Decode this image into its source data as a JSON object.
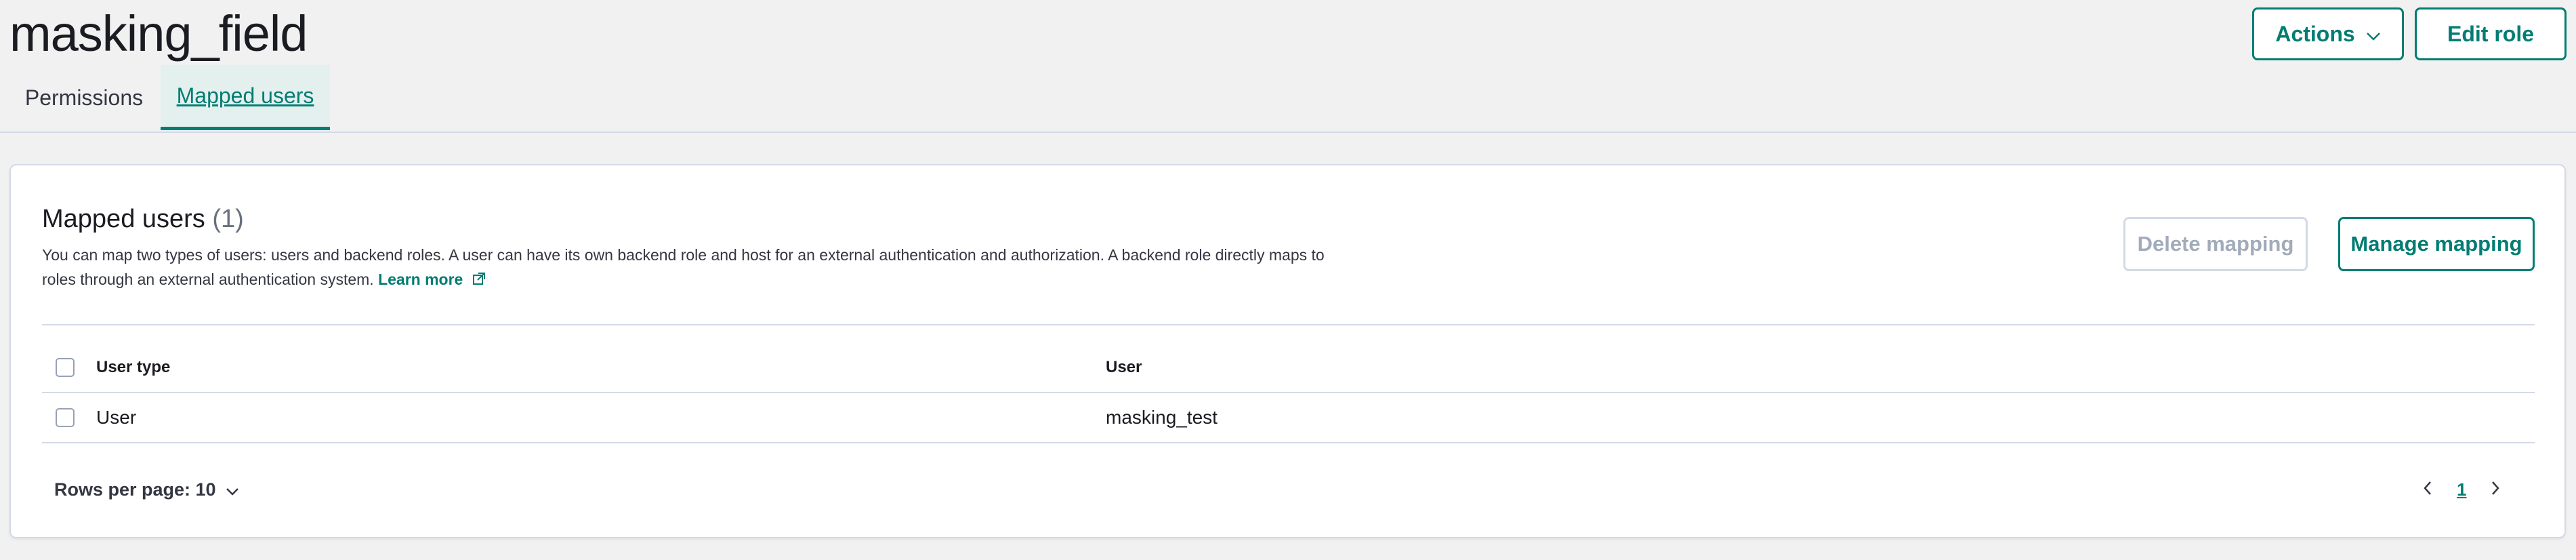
{
  "page": {
    "title": "masking_field"
  },
  "header_actions": {
    "actions_label": "Actions",
    "edit_role_label": "Edit role"
  },
  "tabs": [
    {
      "label": "Permissions",
      "active": false
    },
    {
      "label": "Mapped users",
      "active": true
    }
  ],
  "mapped_users": {
    "title": "Mapped users",
    "count": "(1)",
    "description": "You can map two types of users: users and backend roles. A user can have its own backend role and host for an external authentication and authorization. A backend role directly maps to roles through an external authentication system.",
    "learn_more": "Learn more",
    "delete_mapping_label": "Delete mapping",
    "manage_mapping_label": "Manage mapping"
  },
  "table": {
    "columns": [
      "User type",
      "User"
    ],
    "rows": [
      {
        "user_type": "User",
        "user": "masking_test"
      }
    ]
  },
  "pagination": {
    "rows_per_page": "Rows per page: 10",
    "current_page": "1"
  },
  "colors": {
    "accent": "#017d73",
    "disabled": "#a2abba",
    "border": "#d3dae6",
    "background": "#f1f1f2"
  },
  "icons": {
    "actions_caret": "chevron-down-icon",
    "learn_more": "external-link-icon",
    "rows_per_page": "chevron-down-icon",
    "prev": "chevron-left-icon",
    "next": "chevron-right-icon"
  }
}
